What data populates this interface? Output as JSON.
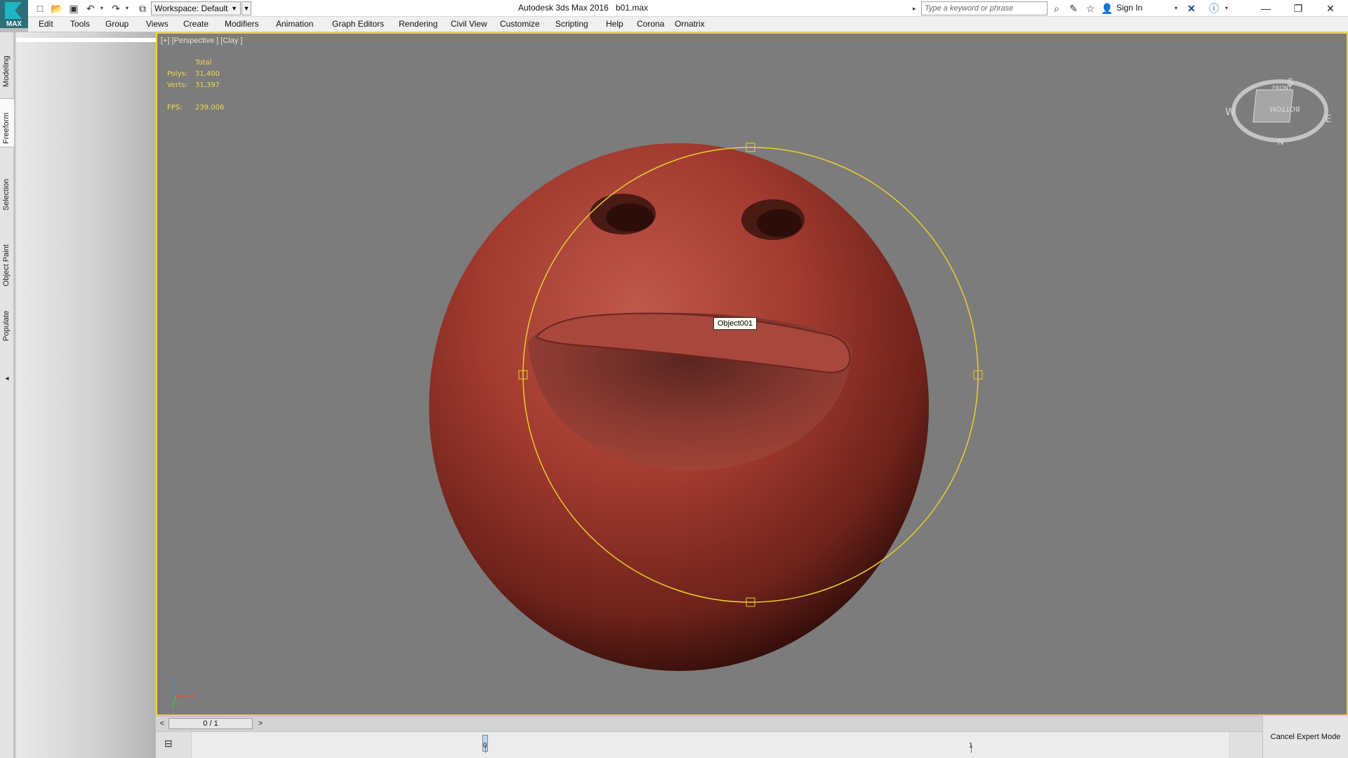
{
  "app": {
    "logo_text": "MAX",
    "title": "Autodesk 3ds Max 2016",
    "file_name": "b01.max"
  },
  "quick_access": {
    "workspace_label": "Workspace: Default",
    "search_placeholder": "Type a keyword or phrase",
    "sign_in_label": "Sign In"
  },
  "menu": {
    "items": [
      "Edit",
      "Tools",
      "Group",
      "Views",
      "Create",
      "Modifiers",
      "Animation",
      "Graph Editors",
      "Rendering",
      "Civil View",
      "Customize",
      "Scripting",
      "Help",
      "Corona",
      "Ornatrix"
    ]
  },
  "ribbon_tabs": [
    "Modeling",
    "Freeform",
    "Selection",
    "Object Paint",
    "Populate"
  ],
  "viewport": {
    "label": "[+] [Perspective ] [Clay ]",
    "stats": {
      "total_label": "Total",
      "polys_label": "Polys:",
      "polys_value": "31,400",
      "verts_label": "Verts:",
      "verts_value": "31,397",
      "fps_label": "FPS:",
      "fps_value": "239.006"
    },
    "tooltip": "Object001",
    "viewcube": {
      "face_label": "BOTTOM",
      "front_label": "FRONT",
      "compass_s": "S",
      "compass_n": "N",
      "compass_w": "W",
      "compass_e": "E"
    },
    "axis": {
      "x": "x",
      "z": "z"
    }
  },
  "timeline": {
    "frame_display": "0 / 1",
    "prev_label": "<",
    "next_label": ">",
    "tick_start": "0",
    "tick_end": "1"
  },
  "expert_mode": {
    "cancel_label": "Cancel Expert Mode"
  },
  "colors": {
    "viewport_bg": "#7c7c7c",
    "active_border": "#f4d13a",
    "stats_text": "#f1d94a",
    "object_red": "#a23a2f"
  }
}
